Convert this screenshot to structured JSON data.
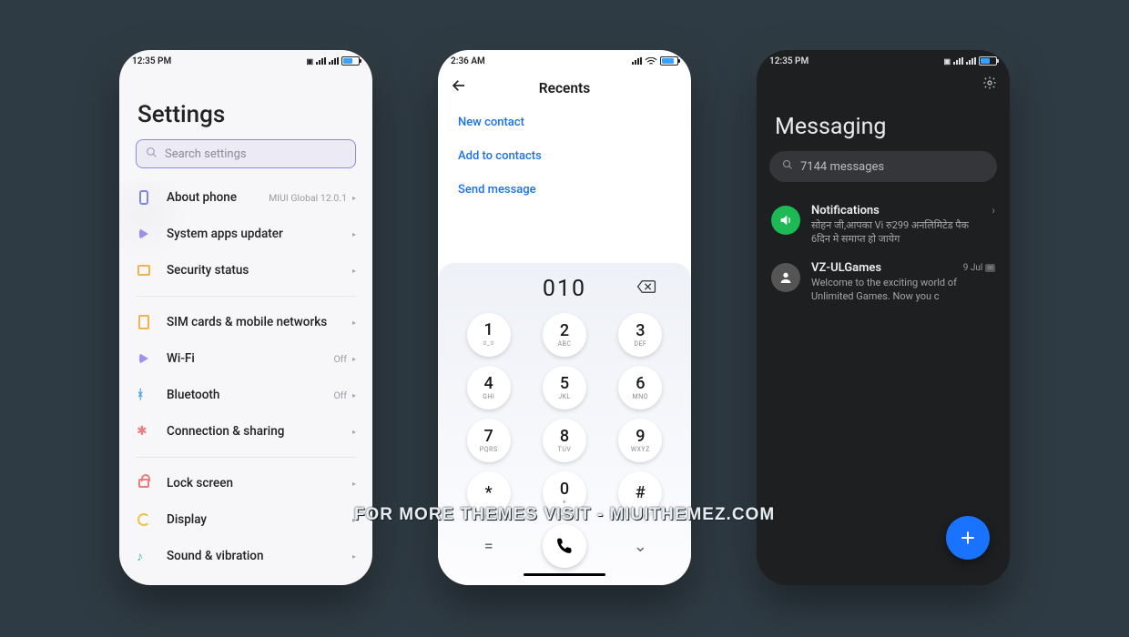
{
  "watermark": "FOR MORE THEMES VISIT - MIUITHEMEZ.COM",
  "settings": {
    "status_time": "12:35 PM",
    "title": "Settings",
    "search_placeholder": "Search settings",
    "rows": [
      {
        "icon": "phone-icon",
        "label": "About phone",
        "value": "MIUI Global 12.0.1"
      },
      {
        "icon": "apps-icon",
        "label": "System apps updater",
        "value": ""
      },
      {
        "icon": "shield-icon",
        "label": "Security status",
        "value": ""
      },
      {
        "sep": true
      },
      {
        "icon": "sim-icon",
        "label": "SIM cards & mobile networks",
        "value": ""
      },
      {
        "icon": "wifi-icon",
        "label": "Wi-Fi",
        "value": "Off"
      },
      {
        "icon": "bluetooth-icon",
        "label": "Bluetooth",
        "value": "Off"
      },
      {
        "icon": "link-icon",
        "label": "Connection & sharing",
        "value": ""
      },
      {
        "sep": true
      },
      {
        "icon": "lock-icon",
        "label": "Lock screen",
        "value": ""
      },
      {
        "icon": "moon-icon",
        "label": "Display",
        "value": ""
      },
      {
        "icon": "sound-icon",
        "label": "Sound & vibration",
        "value": ""
      }
    ]
  },
  "dialer": {
    "status_time": "2:36 AM",
    "title": "Recents",
    "links": [
      "New contact",
      "Add to contacts",
      "Send message"
    ],
    "number": "010",
    "keys": [
      {
        "d": "1",
        "s": "ಠ_ಠ"
      },
      {
        "d": "2",
        "s": "ABC"
      },
      {
        "d": "3",
        "s": "DEF"
      },
      {
        "d": "4",
        "s": "GHI"
      },
      {
        "d": "5",
        "s": "JKL"
      },
      {
        "d": "6",
        "s": "MNO"
      },
      {
        "d": "7",
        "s": "PQRS"
      },
      {
        "d": "8",
        "s": "TUV"
      },
      {
        "d": "9",
        "s": "WXYZ"
      },
      {
        "d": "*",
        "s": ""
      },
      {
        "d": "0",
        "s": "+"
      },
      {
        "d": "#",
        "s": ""
      }
    ],
    "bottom": {
      "left": "=",
      "right": "⌄"
    }
  },
  "messaging": {
    "status_time": "12:35 PM",
    "title": "Messaging",
    "search_text": "7144 messages",
    "threads": [
      {
        "avatar": "speaker-icon",
        "avatar_color": "green",
        "name": "Notifications",
        "date": "",
        "preview": "सोहन जी,आपका Vi रु299 अनलिमिटेड पैक 6दिन मे समाप्त हो जायेग",
        "chevron": true
      },
      {
        "avatar": "person-icon",
        "avatar_color": "gray",
        "name": "VZ-ULGames",
        "date": "9 Jul",
        "preview": "Welcome to the exciting world of Unlimited Games. Now you c",
        "chevron": false,
        "badge": true
      }
    ]
  }
}
